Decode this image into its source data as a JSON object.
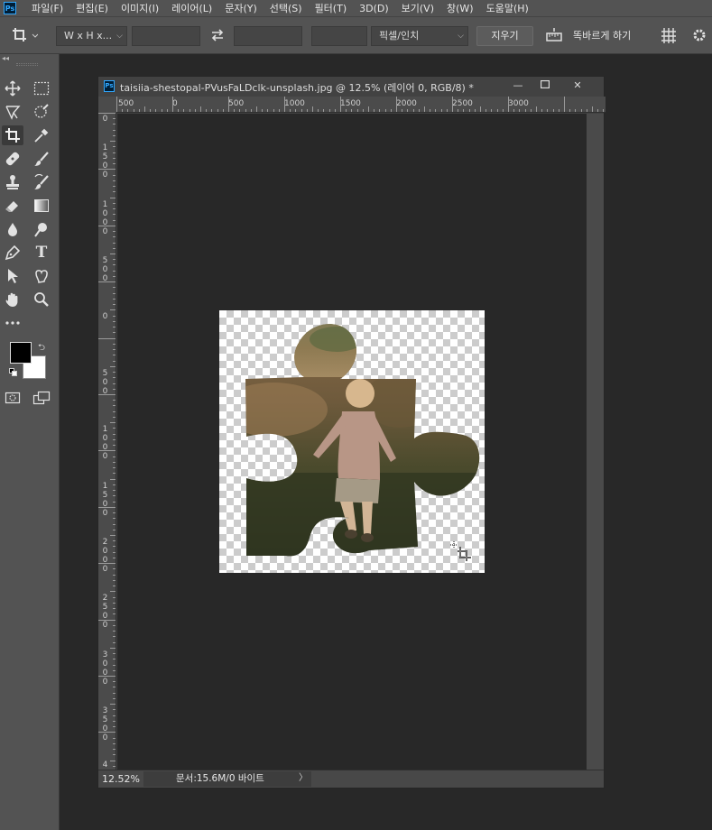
{
  "menubar": {
    "logo": "Ps",
    "items": [
      "파일(F)",
      "편집(E)",
      "이미지(I)",
      "레이어(L)",
      "문자(Y)",
      "선택(S)",
      "필터(T)",
      "3D(D)",
      "보기(V)",
      "창(W)",
      "도움말(H)"
    ]
  },
  "options": {
    "ratio_label": "W x H x...",
    "unit_label": "픽셀/인치",
    "clear_label": "지우기",
    "straighten_label": "똑바르게 하기"
  },
  "colors": {
    "foreground": "#000000",
    "background": "#ffffff"
  },
  "document": {
    "icon": "Ps",
    "title": "taisiia-shestopal-PVusFaLDclk-unsplash.jpg @ 12.5% (레이어 0, RGB/8) *",
    "ruler_h_labels": [
      "500",
      "0",
      "500",
      "1000",
      "1500",
      "2000",
      "2500",
      "3000"
    ],
    "ruler_v_labels": [
      "0",
      "1500",
      "1000",
      "500",
      "0",
      "500",
      "1000",
      "1500",
      "2000",
      "2500",
      "3000",
      "3500",
      "4"
    ],
    "zoom": "12.52%",
    "doc_info": "문서:15.6M/0 바이트",
    "doc_info_arrow": "〉"
  }
}
